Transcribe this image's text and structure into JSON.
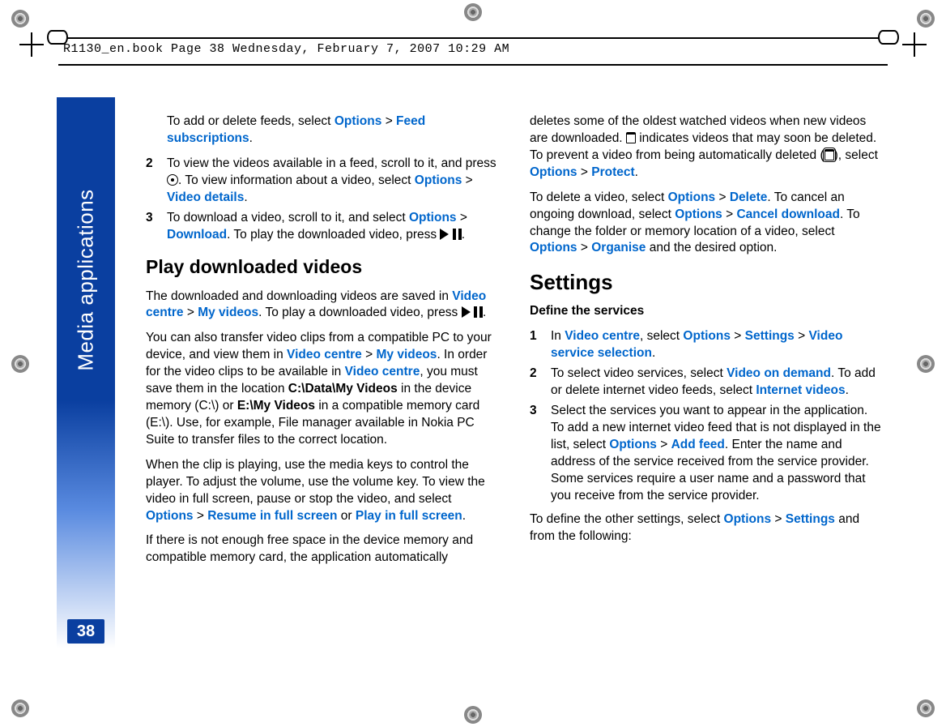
{
  "header": {
    "running": "R1130_en.book  Page 38  Wednesday, February 7, 2007  10:29 AM"
  },
  "sidebar": {
    "section": "Media applications",
    "page": "38"
  },
  "ui": {
    "options": "Options",
    "feed_subscriptions": "Feed subscriptions",
    "video_details": "Video details",
    "download": "Download",
    "video_centre": "Video centre",
    "my_videos": "My videos",
    "resume_full": "Resume in full screen",
    "play_full": "Play in full screen",
    "protect": "Protect",
    "delete": "Delete",
    "cancel_download": "Cancel download",
    "organise": "Organise",
    "settings": "Settings",
    "video_service_selection": "Video service selection",
    "video_on_demand": "Video on demand",
    "internet_videos": "Internet videos",
    "add_feed": "Add feed"
  },
  "l": {
    "p0a": "To add or delete feeds, select ",
    "s2": {
      "n": "2",
      "a": "To view the videos available in a feed, scroll to it, and press ",
      "b": ". To view information about a video, select "
    },
    "s3": {
      "n": "3",
      "a": "To download a video, scroll to it, and select ",
      "b": ". To play the downloaded video, press "
    },
    "h_play": "Play downloaded videos",
    "p1a": "The downloaded and downloading videos are saved in ",
    "p1b": ". To play a downloaded video, press ",
    "p2a": "You can also transfer video clips from a compatible PC to your device, and view them in ",
    "p2b": ". In order for the video clips to be available in ",
    "p2c": ", you must save them in the location ",
    "path1": "C:\\Data\\My Videos",
    "p2d": " in the device memory (C:\\) or ",
    "path2": "E:\\My Videos",
    "p2e": " in a compatible memory card (E:\\). Use, for example, File manager available in Nokia PC Suite to transfer files to the correct location.",
    "p3a": "When the clip is playing, use the media keys to control the player. To adjust the volume, use the volume key. To view the video in full screen, pause or stop the video, and select ",
    "or": " or ",
    "p4": "If there is not enough free space in the device memory and compatible memory card, the application automatically"
  },
  "r": {
    "p0a": "deletes some of the oldest watched videos when new videos are downloaded. ",
    "p0b": " indicates videos that may soon be deleted. To prevent a video from being automatically deleted ",
    "p0c": "), select ",
    "p1a": "To delete a video, select ",
    "p1b": ". To cancel an ongoing download, select ",
    "p1c": ". To change the folder or memory location of a video, select ",
    "p1d": " and the desired option.",
    "h_settings": "Settings",
    "h_define": "Define the services",
    "s1": {
      "n": "1",
      "a": "In ",
      "b": ", select "
    },
    "s2": {
      "n": "2",
      "a": "To select video services, select ",
      "b": ". To add or delete internet video feeds, select "
    },
    "s3": {
      "n": "3",
      "a": "Select the services you want to appear in the application.",
      "b": "To add a new internet video feed that is not displayed in the list, select ",
      "c": ". Enter the name and address of the service received from the service provider.",
      "d": "Some services require a user name and a password that you receive from the service provider."
    },
    "p2a": "To define the other settings, select ",
    "p2b": " and from the following:"
  }
}
